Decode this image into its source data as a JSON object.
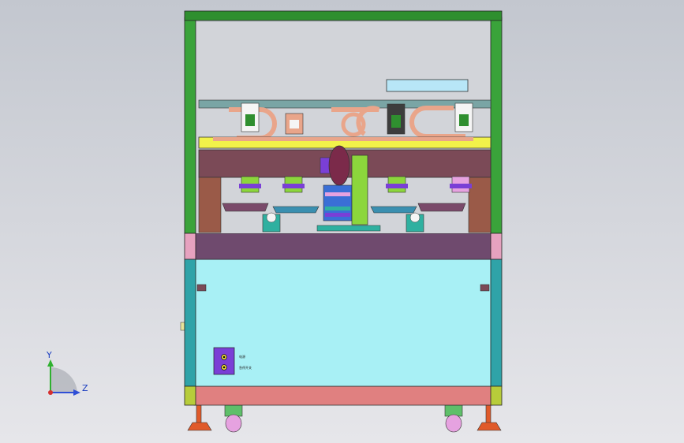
{
  "viewport": {
    "background_top": "#c3c7cf",
    "background_bottom": "#e6e6ea"
  },
  "machine": {
    "frame_color": "#3aa33a",
    "top_bar_color": "#2f8f2f",
    "upper_beam_color": "#7b4a57",
    "middle_panel_color": "#6f4a6e",
    "door_panel_color": "#a8f0f5",
    "base_panel_color": "#e08080",
    "gantry_color": "#f2f24a",
    "arm_color": "#e9a58a",
    "column_color": "#8cd63c",
    "control_box_color": "#7a3fd6",
    "control_box_labels": [
      "电源",
      "急停开关"
    ]
  },
  "triad": {
    "y_label": "Y",
    "z_label": "Z",
    "y_color": "#2fb02f",
    "z_color": "#2f4fd6",
    "x_color": "#d62f2f"
  }
}
